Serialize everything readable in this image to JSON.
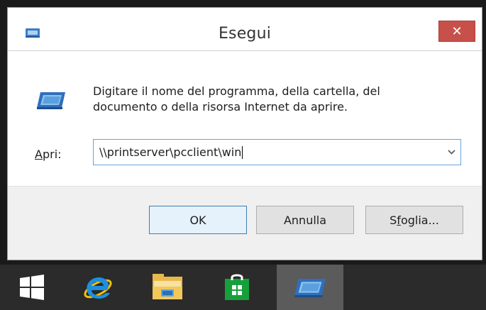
{
  "dialog": {
    "title": "Esegui",
    "close_label": "✕",
    "description": "Digitare il nome del programma, della cartella, del documento o della risorsa Internet da aprire.",
    "open_label_underlined": "A",
    "open_label_rest": "pri:",
    "open_value": "\\\\printserver\\pcclient\\win",
    "dropdown_arrow": "⌄",
    "buttons": {
      "ok": "OK",
      "cancel": "Annulla",
      "browse_prefix": "S",
      "browse_underlined": "f",
      "browse_suffix": "oglia..."
    }
  },
  "colors": {
    "close": "#c7514a",
    "focus_border": "#6aa1d8",
    "taskbar": "#2b2b2b",
    "taskbar_active": "#5b5b5b"
  },
  "taskbar": {
    "items": [
      {
        "name": "start-button",
        "icon": "windows-logo-icon"
      },
      {
        "name": "internet-explorer",
        "icon": "internet-explorer-icon"
      },
      {
        "name": "file-explorer",
        "icon": "folder-icon"
      },
      {
        "name": "store",
        "icon": "store-bag-icon"
      },
      {
        "name": "run",
        "icon": "run-icon",
        "active": true
      }
    ]
  }
}
